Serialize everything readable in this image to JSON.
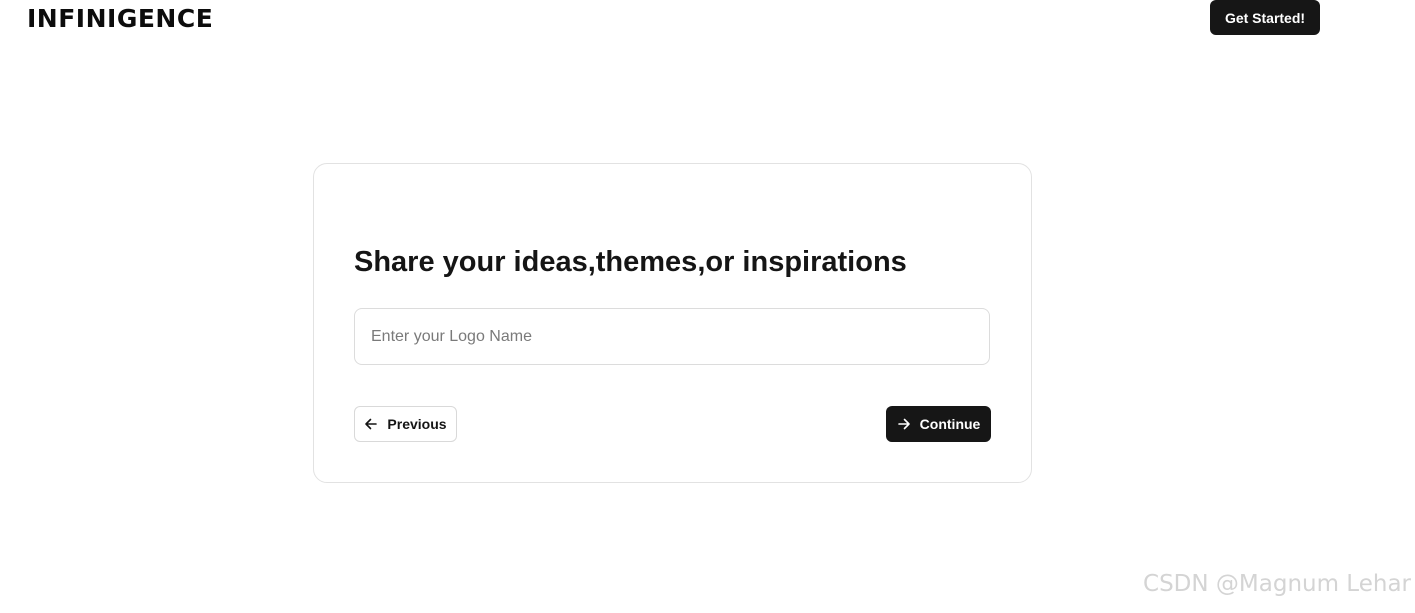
{
  "header": {
    "logo_text": "INFINIGENCE",
    "cta_label": "Get Started!"
  },
  "card": {
    "title": "Share your ideas,themes,or inspirations",
    "input": {
      "placeholder": "Enter your Logo Name",
      "value": ""
    },
    "previous_label": "Previous",
    "continue_label": "Continue"
  },
  "icons": {
    "previous": "arrow-left-icon",
    "continue": "arrow-right-icon"
  },
  "colors": {
    "primary_button": "#161616",
    "background": "#ffffff",
    "border": "#e2e2e2"
  },
  "watermark": "CSDN @Magnum Lehar"
}
